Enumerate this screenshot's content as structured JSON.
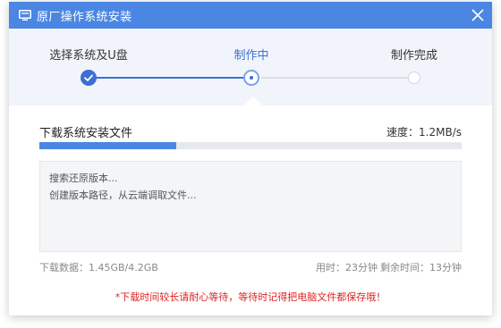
{
  "window": {
    "title": "原厂操作系统安装"
  },
  "icons": {
    "app": "monitor-icon",
    "close": "close-icon",
    "step_done": "check-icon"
  },
  "colors": {
    "accent": "#4b86e3",
    "step_active": "#3b6fd4",
    "warning": "#e02424"
  },
  "steps": [
    {
      "label": "选择系统及U盘",
      "state": "done"
    },
    {
      "label": "制作中",
      "state": "current"
    },
    {
      "label": "制作完成",
      "state": "pending"
    }
  ],
  "download": {
    "title": "下载系统安装文件",
    "speed": "速度：1.2MB/s",
    "progress": 0.325
  },
  "log": [
    "搜索还原版本...",
    "创建版本路径，从云端调取文件..."
  ],
  "stats": {
    "downloaded": "下载数据：1.45GB/4.2GB",
    "elapsed": "用时：23分钟",
    "remaining": "剩余时间：13分钟"
  },
  "warning": "*下载时间较长请耐心等待，等待时记得把电脑文件都保存哦！"
}
